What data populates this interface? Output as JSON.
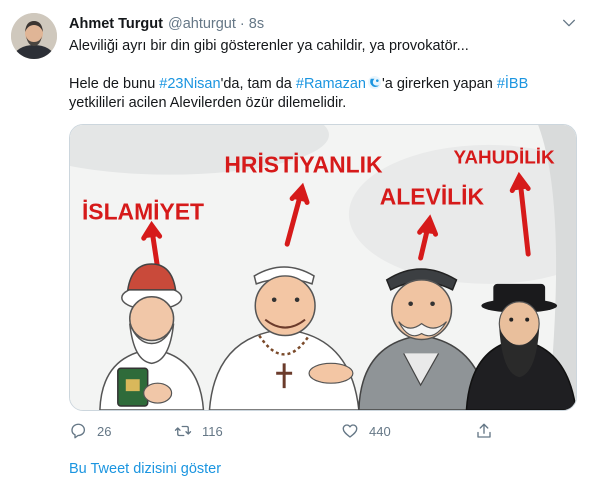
{
  "author": {
    "name": "Ahmet Turgut",
    "handle": "@ahturgut",
    "separator": "·",
    "time": "8s"
  },
  "tweet": {
    "line1": "Aleviliği ayrı bir din gibi gösterenler ya cahildir, ya provokatör...",
    "p2_a": "Hele de bunu ",
    "tag1": "#23Nisan",
    "p2_b": "'da, tam da ",
    "tag2": "#Ramazan",
    "p2_c": "'a girerken yapan ",
    "tag3": "#İBB",
    "line3": "yetkilileri acilen Alevilerden özür dilemelidir."
  },
  "image_labels": {
    "islam": "İSLAMİYET",
    "christian": "HRİSTİYANLIK",
    "alevi": "ALEVİLİK",
    "jewish": "YAHUDİLİK"
  },
  "actions": {
    "replies": "26",
    "retweets": "116",
    "likes": "440"
  },
  "thread_link": "Bu Tweet dizisini göster",
  "icons": [
    "chevron-down-icon",
    "reply-icon",
    "retweet-icon",
    "like-icon",
    "share-icon",
    "ramazan-wave-icon"
  ],
  "colors": {
    "accent": "#1b95e0",
    "muted": "#657786",
    "text": "#14171a",
    "label_red": "#d61a1a"
  }
}
